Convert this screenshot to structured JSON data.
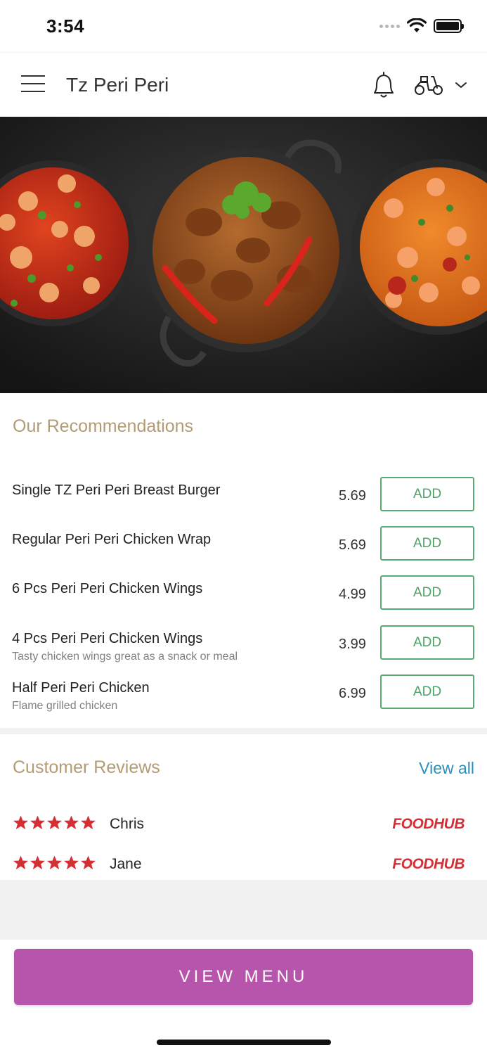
{
  "status_bar": {
    "time": "3:54"
  },
  "header": {
    "title": "Tz Peri Peri",
    "icons": [
      "menu-icon",
      "bell-icon",
      "scooter-icon",
      "chevron-down-icon"
    ]
  },
  "hero": {
    "image": "curry-dishes-photo"
  },
  "recommendations": {
    "title": "Our Recommendations",
    "items": [
      {
        "name": "Single TZ Peri Peri Breast Burger",
        "description": "",
        "price": "5.69",
        "button": "ADD"
      },
      {
        "name": "Regular Peri Peri Chicken Wrap",
        "description": "",
        "price": "5.69",
        "button": "ADD"
      },
      {
        "name": "6 Pcs Peri Peri Chicken Wings",
        "description": "",
        "price": "4.99",
        "button": "ADD"
      },
      {
        "name": "4 Pcs Peri Peri Chicken Wings",
        "description": "Tasty chicken wings great as a snack or meal",
        "price": "3.99",
        "button": "ADD"
      },
      {
        "name": "Half Peri Peri Chicken",
        "description": "Flame grilled chicken",
        "price": "6.99",
        "button": "ADD"
      }
    ]
  },
  "reviews": {
    "title": "Customer Reviews",
    "view_all": "View all",
    "items": [
      {
        "name": "Chris",
        "rating": 5,
        "source": "FOODHUB"
      },
      {
        "name": "Jane",
        "rating": 5,
        "source": "FOODHUB"
      }
    ]
  },
  "footer": {
    "view_menu": "VIEW MENU"
  },
  "colors": {
    "accent_title": "#b39c74",
    "add_green": "#5aaa73",
    "link_blue": "#2a8fbd",
    "star_red": "#d52f36",
    "view_menu_purple": "#b755ad"
  }
}
